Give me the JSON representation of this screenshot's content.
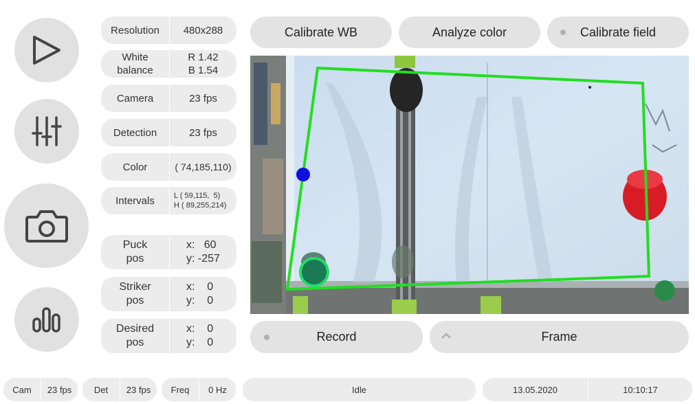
{
  "nav": {
    "items": [
      {
        "name": "play-icon"
      },
      {
        "name": "sliders-icon"
      },
      {
        "name": "camera-icon"
      },
      {
        "name": "chart-icon"
      }
    ]
  },
  "info": {
    "resolution": {
      "label": "Resolution",
      "value": "480x288"
    },
    "white_balance": {
      "label_line1": "White",
      "label_line2": "balance",
      "value_line1": "R 1.42",
      "value_line2": "B 1.54"
    },
    "camera": {
      "label": "Camera",
      "value": "23 fps"
    },
    "detection": {
      "label": "Detection",
      "value": "23 fps"
    },
    "color": {
      "label": "Color",
      "value": "( 74,185,110)"
    },
    "intervals": {
      "label": "Intervals",
      "low": "L ( 59,115,  5)",
      "high": "H ( 89,255,214)"
    },
    "puck": {
      "label_line1": "Puck",
      "label_line2": "pos",
      "x": "x:   60",
      "y": "y: -257"
    },
    "striker": {
      "label_line1": "Striker",
      "label_line2": "pos",
      "x": "x:    0",
      "y": "y:    0"
    },
    "desired": {
      "label_line1": "Desired",
      "label_line2": "pos",
      "x": "x:    0",
      "y": "y:    0"
    }
  },
  "toolbar": {
    "calibrate_wb": "Calibrate WB",
    "analyze_color": "Analyze color",
    "calibrate_field": "Calibrate field",
    "record": "Record",
    "frame": "Frame"
  },
  "status": {
    "cam_label": "Cam",
    "cam_value": "23 fps",
    "det_label": "Det",
    "det_value": "23 fps",
    "freq_label": "Freq",
    "freq_value": "0 Hz",
    "state": "Idle",
    "date": "13.05.2020",
    "time": "10:10:17"
  },
  "colors": {
    "field_outline": "#22dd22",
    "puck_marker": "#1a9e5a",
    "blue_marker": "#1010e0",
    "red_striker": "#d81c26",
    "green_corner": "#2a8a4a"
  }
}
